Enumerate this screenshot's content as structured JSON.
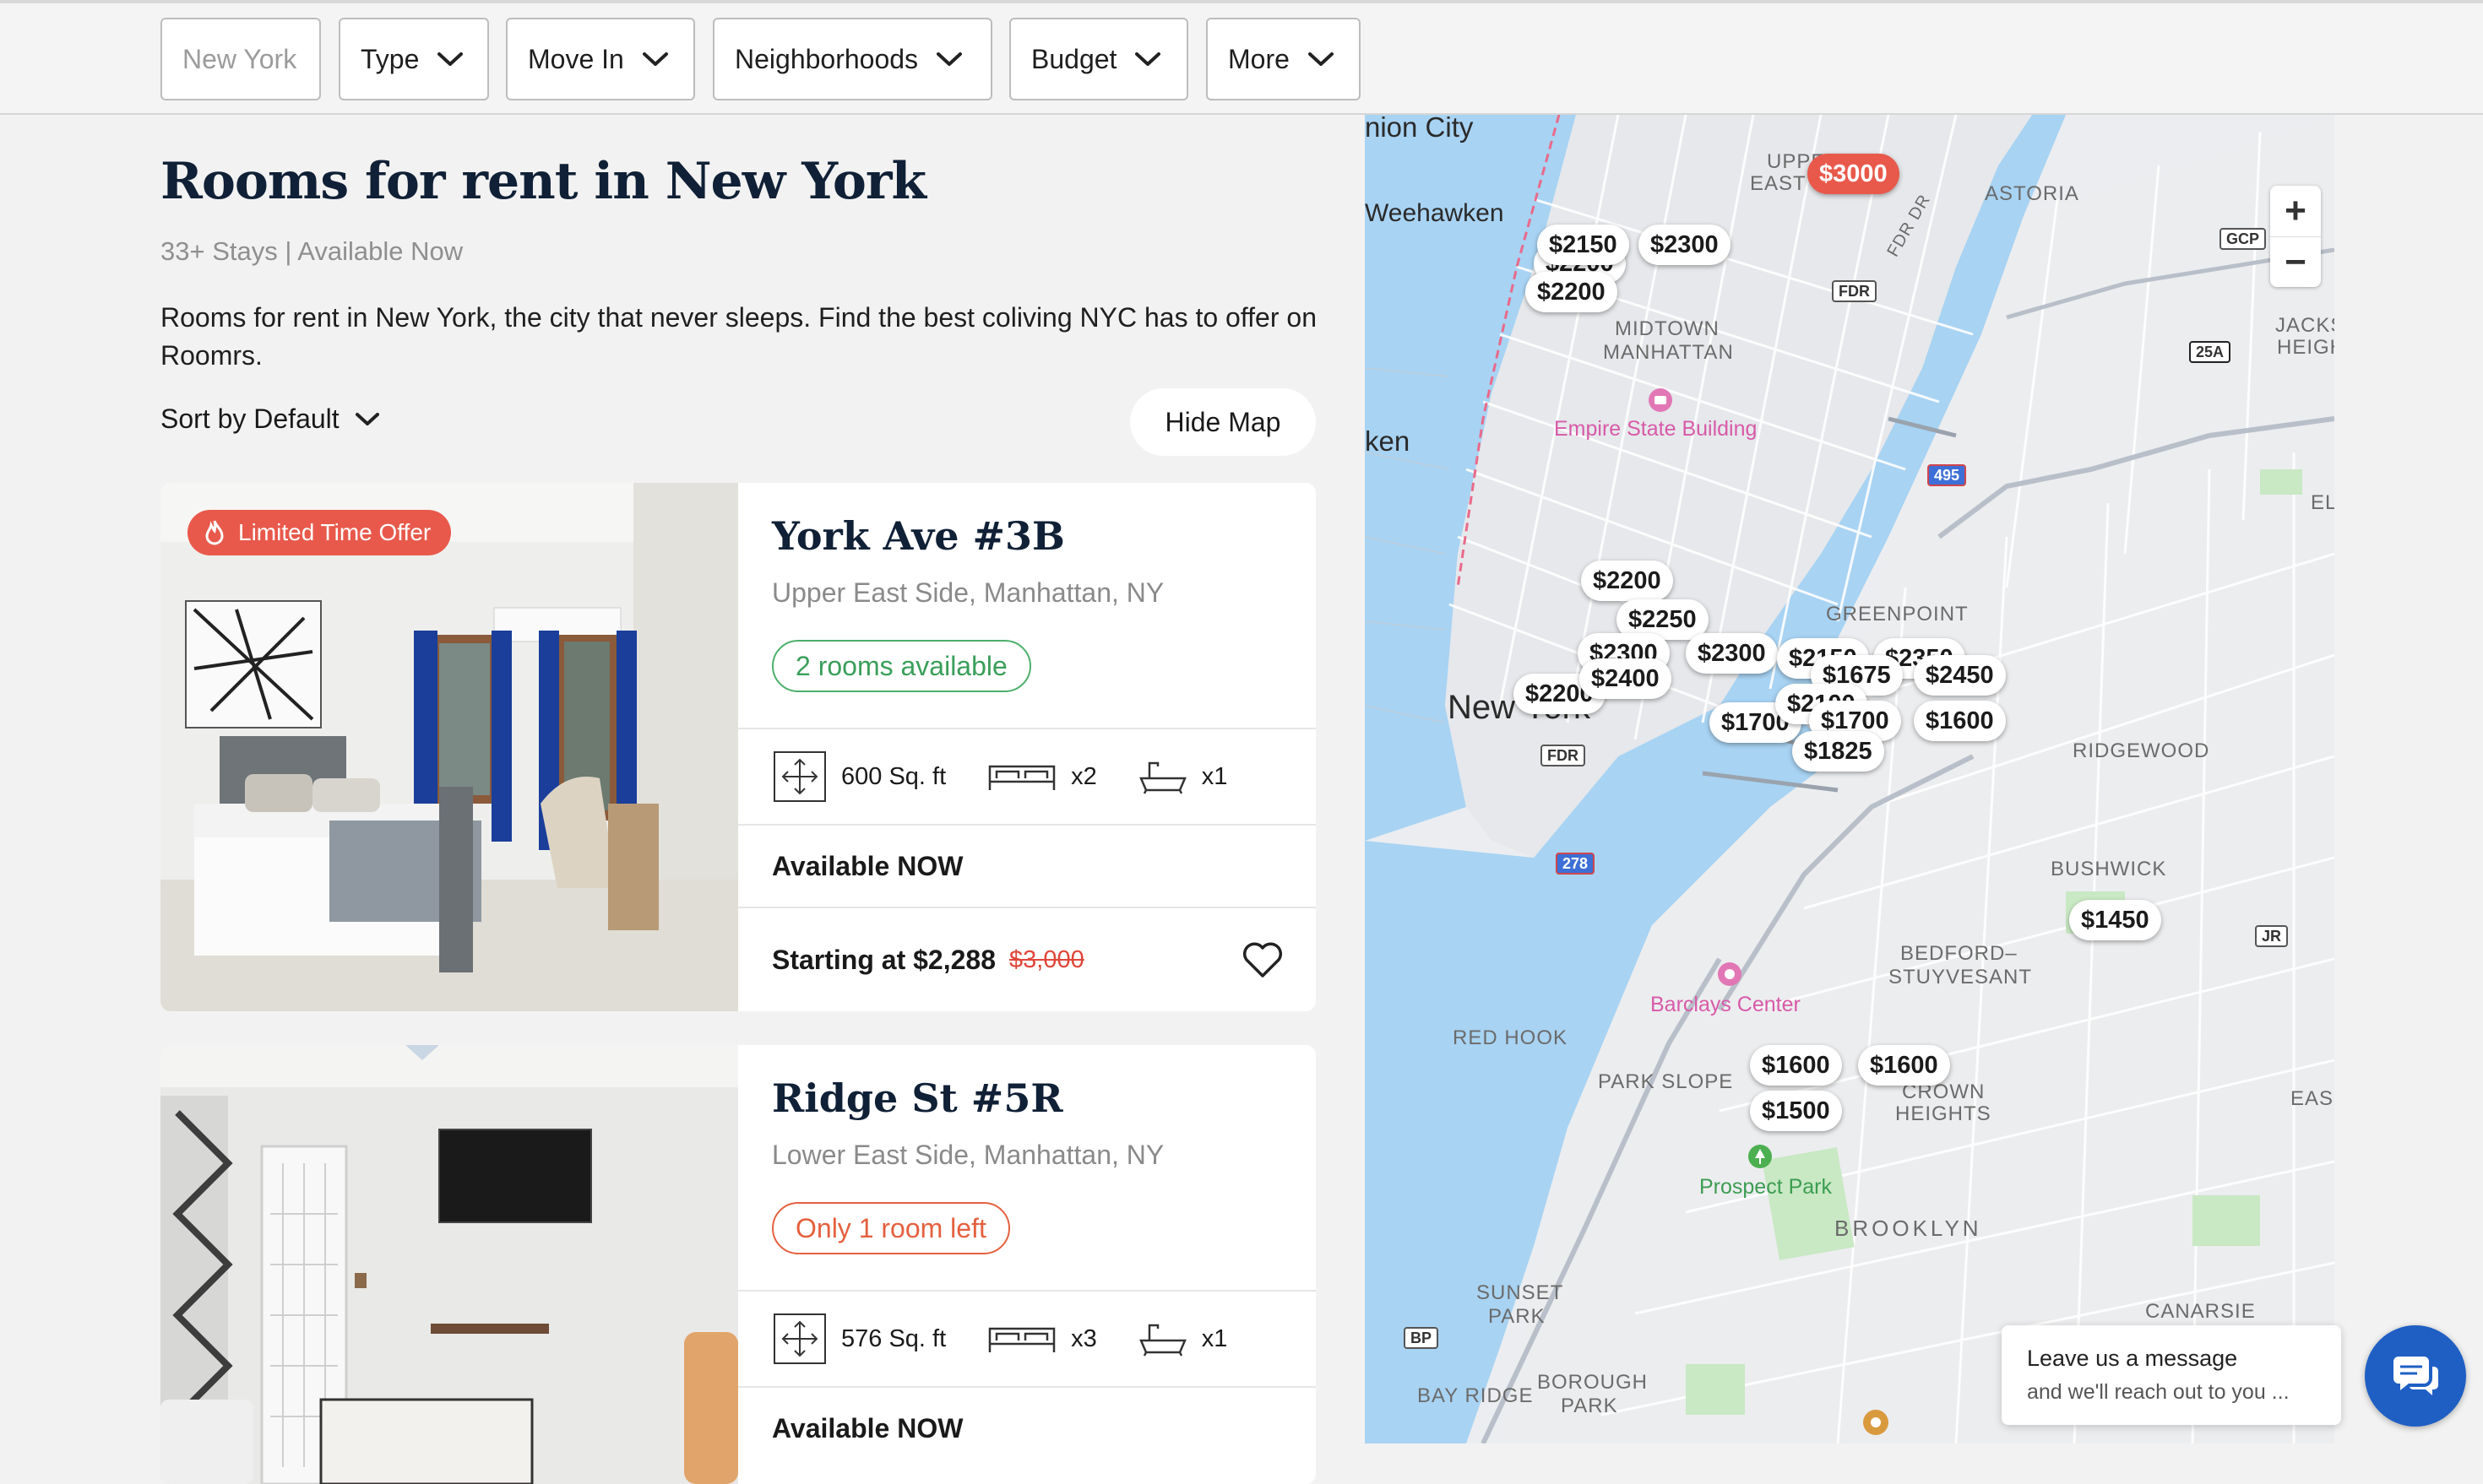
{
  "filters": {
    "search_placeholder": "New York",
    "type": "Type",
    "move_in": "Move In",
    "neighborhoods": "Neighborhoods",
    "budget": "Budget",
    "more": "More"
  },
  "header": {
    "title": "Rooms for rent in New York",
    "subtitle": "33+ Stays | Available Now",
    "description": "Rooms for rent in New York, the city that never sleeps. Find the best coliving NYC has to offer on Roomrs.",
    "sort_label": "Sort by Default",
    "hide_map": "Hide Map"
  },
  "listings": [
    {
      "badge": "Limited Time Offer",
      "name": "York Ave #3B",
      "location": "Upper East Side, Manhattan, NY",
      "availability_pill": "2 rooms available",
      "sqft": "600 Sq. ft",
      "beds": "x2",
      "baths": "x1",
      "available": "Available NOW",
      "price_prefix": "Starting at $2,288",
      "old_price": "$3,000"
    },
    {
      "name": "Ridge St #5R",
      "location": "Lower East Side, Manhattan, NY",
      "availability_pill": "Only 1 room left",
      "sqft": "576 Sq. ft",
      "beds": "x3",
      "baths": "x1",
      "available": "Available NOW"
    }
  ],
  "map": {
    "labels": {
      "union_city": "nion City",
      "weehawken": "Weehawken",
      "upper_east": "UPPER",
      "upper_east2": "EAST",
      "astoria": "ASTORIA",
      "midtown": "MIDTOWN",
      "manhattan": "MANHATTAN",
      "empire": "Empire State Building",
      "hoboken": "ken",
      "greenpoint": "GREENPOINT",
      "new_york": "New York",
      "ridgewood": "RIDGEWOOD",
      "bushwick": "BUSHWICK",
      "bedford": "BEDFORD–",
      "stuyvesant": "STUYVESANT",
      "barclays": "Barclays Center",
      "red_hook": "RED HOOK",
      "park_slope": "PARK SLOPE",
      "crown": "CROWN",
      "heights": "HEIGHTS",
      "prospect": "Prospect Park",
      "brooklyn": "BROOKLYN",
      "sunset": "SUNSET",
      "park": "PARK",
      "borough": "BOROUGH",
      "borough_park": "PARK",
      "bay_ridge": "BAY RIDGE",
      "canarsie": "CANARSIE",
      "jackson": "JACKS",
      "jackson2": "HEIGH",
      "east_ny": "EAS",
      "el": "EL",
      "fdr_dr": "FDR DR"
    },
    "shields": {
      "gcp": "GCP",
      "fdr": "FDR",
      "fdr2": "FDR",
      "r25a": "25A",
      "i495": "495",
      "i278": "278",
      "jr": "JR",
      "bp": "BP"
    },
    "prices": {
      "p3000": "$3000",
      "p2150a": "$2150",
      "p2300a": "$2300",
      "p2200a": "$2200",
      "p2200b": "$2200",
      "p2250": "$2250",
      "p2300b": "$2300",
      "p2300c": "$2300",
      "p2150b": "$2150",
      "p2350": "$2350",
      "p1675": "$1675",
      "p2450": "$2450",
      "p2200c": "$2200",
      "p2400": "$2400",
      "p1700a": "$1700",
      "p2100": "$2100",
      "p1700b": "$1700",
      "p1600a": "$1600",
      "p1825": "$1825",
      "p1450": "$1450",
      "p1600b": "$1600",
      "p1600c": "$1600",
      "p1500": "$1500"
    },
    "zoom_in": "+",
    "zoom_out": "−"
  },
  "chat": {
    "line1": "Leave us a message",
    "line2": "and we'll reach out to you ..."
  }
}
